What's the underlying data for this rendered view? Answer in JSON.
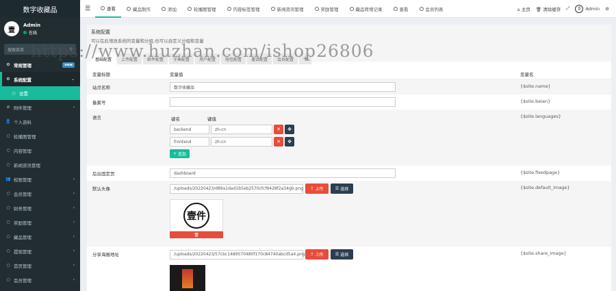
{
  "brand": "数字收藏品",
  "user": {
    "name": "Admin",
    "status": "在线",
    "avatar_char": "壹"
  },
  "search": {
    "placeholder": "搜索菜单"
  },
  "menu": [
    {
      "label": "常规管理",
      "icon": "gears-icon",
      "type": "header",
      "badge": "new"
    },
    {
      "label": "系统配置",
      "icon": "gear-icon",
      "type": "active-parent",
      "chevron": "⌄"
    },
    {
      "label": "设置",
      "icon": "circle-icon",
      "type": "active"
    },
    {
      "label": "附件管理",
      "icon": "paperclip-icon",
      "type": "plain",
      "chevron": "‹"
    },
    {
      "label": "个人资料",
      "icon": "user-icon",
      "type": "plain"
    },
    {
      "label": "轮播图管理",
      "icon": "circle-icon",
      "type": "plain"
    },
    {
      "label": "内容管理",
      "icon": "circle-icon",
      "type": "plain"
    },
    {
      "label": "新闻资讯管理",
      "icon": "circle-icon",
      "type": "plain"
    },
    {
      "label": "权限管理",
      "icon": "group-icon",
      "type": "plain",
      "chevron": "‹"
    },
    {
      "label": "会员管理",
      "icon": "circle-icon",
      "type": "plain",
      "chevron": "‹"
    },
    {
      "label": "财务管理",
      "icon": "circle-icon",
      "type": "plain",
      "chevron": "‹"
    },
    {
      "label": "奖励管理",
      "icon": "circle-icon",
      "type": "plain",
      "chevron": "‹"
    },
    {
      "label": "藏品管理",
      "icon": "circle-icon",
      "type": "plain",
      "chevron": "‹"
    },
    {
      "label": "提现管理",
      "icon": "circle-icon",
      "type": "plain",
      "chevron": "‹"
    },
    {
      "label": "首页管理",
      "icon": "circle-icon",
      "type": "plain",
      "chevron": "‹"
    },
    {
      "label": "会员管理",
      "icon": "circle-icon",
      "type": "plain",
      "chevron": "‹"
    }
  ],
  "topnav": {
    "tabs": [
      {
        "label": "查看",
        "active": true
      },
      {
        "label": "藏品制作"
      },
      {
        "label": "添加"
      },
      {
        "label": "轮播图管理"
      },
      {
        "label": "内容标签管理"
      },
      {
        "label": "新闻资讯管理"
      },
      {
        "label": "奖励管理"
      },
      {
        "label": "藏品转增记录"
      },
      {
        "label": "查看"
      },
      {
        "label": "会员列表"
      }
    ],
    "home": "主页",
    "clear_cache": "清除缓存",
    "admin": "Admin"
  },
  "panel": {
    "title": "系统配置",
    "subtitle": "可以在此增改系统的变量和分组,也可以自定义分组和变量",
    "group_tabs": [
      "基础配置",
      "上传配置",
      "邮件配置",
      "字典配置",
      "用户配置",
      "短信配置",
      "邀请配置",
      "会员配置"
    ]
  },
  "table": {
    "headers": {
      "title": "变量标题",
      "value": "变量值",
      "name": "变量名"
    },
    "rows": {
      "site_name": {
        "title": "站点名称",
        "value": "数字收藏品",
        "var": "{$site.name}"
      },
      "beian": {
        "title": "备案号",
        "value": "",
        "var": "{$site.beian}"
      },
      "languages": {
        "title": "语言",
        "key_header": "键名",
        "val_header": "键值",
        "items": [
          {
            "key": "backend",
            "value": "zh-cn"
          },
          {
            "key": "frontend",
            "value": "zh-cn"
          }
        ],
        "add_label": "追加",
        "var": "{$site.languages}"
      },
      "fixedpage": {
        "title": "后台固定页",
        "value": "dashboard",
        "var": "{$site.fixedpage}"
      },
      "default_image": {
        "title": "默认头像",
        "value": "/uploads/20220423/d89a1dad1b5eb2570cfcf9428f2a34gb.png",
        "upload_label": "上传",
        "choose_label": "选择",
        "var": "{$site.default_image}",
        "thumb_char": "壹件"
      },
      "share_image": {
        "title": "分享海报地址",
        "value": "/uploads/20220423/57cbc1489570480f170c84740abcd5a4.png",
        "upload_label": "上传",
        "choose_label": "选择",
        "var": "{$site.share_image}"
      }
    }
  },
  "watermark": "https://www.huzhan.com/ishop26806"
}
